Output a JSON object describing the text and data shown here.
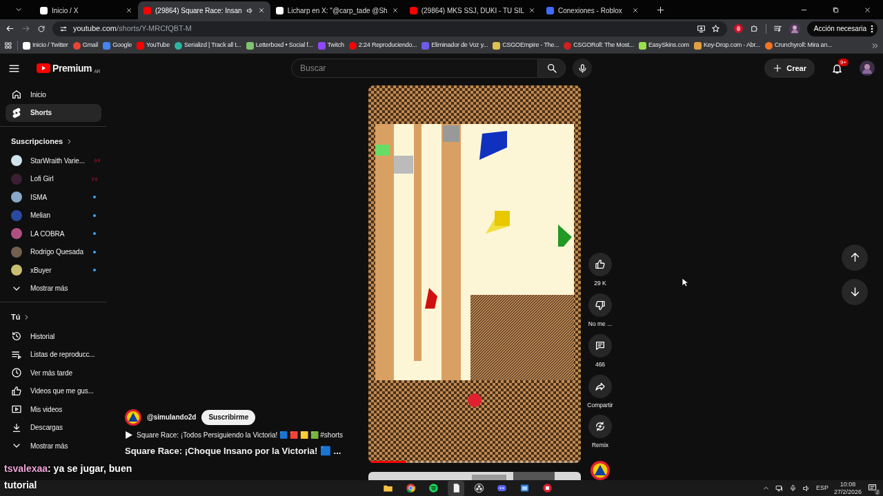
{
  "browser": {
    "tabs": [
      {
        "title": "Inicio / X",
        "selected": false,
        "audio": false
      },
      {
        "title": "(29864) Square Race: Insan",
        "selected": true,
        "audio": true
      },
      {
        "title": "Licharp en X: \"@carp_tade @Sh",
        "selected": false,
        "audio": false
      },
      {
        "title": "(29864) MKS SSJ, DUKI - TU SIL",
        "selected": false,
        "audio": false
      },
      {
        "title": "Conexiones - Roblox",
        "selected": false,
        "audio": false
      }
    ],
    "url_host": "youtube.com",
    "url_path": "/shorts/Y-MRCfQBT-M",
    "profile_button": "Acción necesaria",
    "bookmarks": [
      "Inicio / Twitter",
      "Gmail",
      "Google",
      "YouTube",
      "Serializd | Track all t...",
      "Letterboxd • Social f...",
      "Twitch",
      "2:24 Reproduciendo...",
      "Eliminador de Voz y...",
      "CSGOEmpire - The...",
      "CSGORoll: The Most...",
      "EasySkins.com",
      "Key-Drop.com - Abr...",
      "Crunchyroll: Mira an..."
    ]
  },
  "youtube": {
    "logo": "Premium",
    "region": "AR",
    "search": {
      "placeholder": "Buscar"
    },
    "create_button": "Crear",
    "notification_count": "9+",
    "sidebar": {
      "main": [
        {
          "label": "Inicio",
          "selected": false
        },
        {
          "label": "Shorts",
          "selected": true
        }
      ],
      "subscriptions_heading": "Suscripciones",
      "subscriptions": [
        {
          "name": "StarWraith Varie...",
          "live": true,
          "new_videos": false
        },
        {
          "name": "Lofi Girl",
          "live": true,
          "new_videos": false
        },
        {
          "name": "ISMA",
          "live": false,
          "new_videos": true
        },
        {
          "name": "Melian",
          "live": false,
          "new_videos": true
        },
        {
          "name": "LA COBRA",
          "live": false,
          "new_videos": true
        },
        {
          "name": "Rodrigo Quesada",
          "live": false,
          "new_videos": true
        },
        {
          "name": "xBuyer",
          "live": false,
          "new_videos": true
        }
      ],
      "subscriptions_more": "Mostrar más",
      "you_heading": "Tú",
      "you_items": [
        "Historial",
        "Listas de reproducc...",
        "Ver más tarde",
        "Videos que me gus...",
        "Mis videos",
        "Descargas"
      ],
      "you_more": "Mostrar más"
    },
    "short": {
      "progress": {
        "level": 0.18
      },
      "channel": "@simulando2d",
      "subscribe_button": "Suscribirme",
      "playlist": "Square Race: ¡Todos Persiguiendo la Victoria! 🟦 🟥 🟨 🟩 #shorts",
      "title": "Square Race: ¡Choque Insano por la Victoria! 🟦 ...",
      "actions": [
        {
          "kind": "like",
          "label": "29 K"
        },
        {
          "kind": "dislike",
          "label": "No me ..."
        },
        {
          "kind": "comments",
          "label": "466"
        },
        {
          "kind": "share",
          "label": "Compartir"
        },
        {
          "kind": "remix",
          "label": "Remix"
        }
      ]
    }
  },
  "stream_chat": {
    "user": "tsvalexaa",
    "message": ": ya se jugar, buen tutorial"
  },
  "taskbar": {
    "apps": [
      {
        "selected": false
      },
      {
        "selected": false
      },
      {
        "selected": false
      },
      {
        "selected": true
      },
      {
        "selected": false
      },
      {
        "selected": false
      },
      {
        "selected": false
      },
      {
        "selected": false
      }
    ],
    "language": "ESP",
    "time": "10:08",
    "date": "27/2/2026",
    "notifications": "2"
  }
}
